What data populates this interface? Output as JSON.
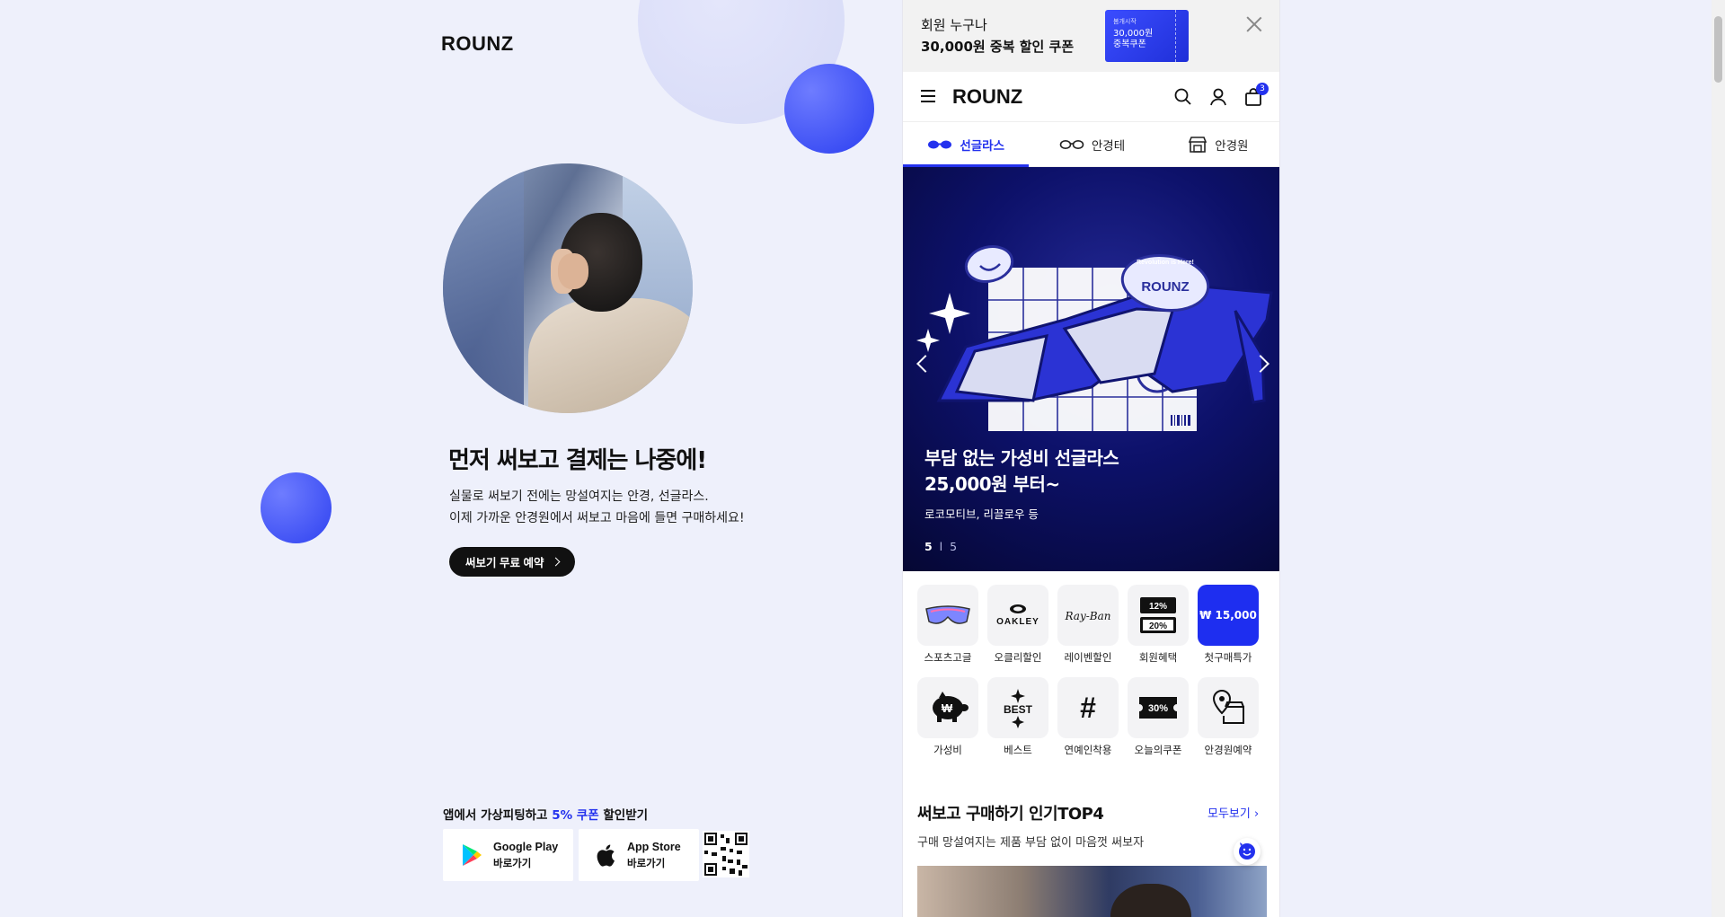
{
  "landing": {
    "brand": "ROUNZ",
    "headline": "먼저 써보고 결제는 나중에!",
    "desc_line1": "실물로 써보기 전에는 망설여지는 안경, 선글라스.",
    "desc_line2": "이제 가까운 안경원에서 써보고 마음에 들면 구매하세요!",
    "try_button": "써보기 무료 예약",
    "app_promo_prefix": "앱에서 가상피팅하고 ",
    "app_promo_highlight": "5% 쿠폰",
    "app_promo_suffix": " 할인받기",
    "google_play": {
      "name": "Google Play",
      "action": "바로가기"
    },
    "app_store": {
      "name": "App Store",
      "action": "바로가기"
    }
  },
  "coupon_bar": {
    "line1": "회원 누구나",
    "line2": "30,000원 중복 할인 쿠폰",
    "ticket_small": "봄개시작",
    "ticket_amount": "30,000원",
    "ticket_label": "중복쿠폰"
  },
  "nav": {
    "brand": "ROUNZ",
    "cart_count": "3"
  },
  "categories": [
    {
      "label": "선글라스",
      "active": true
    },
    {
      "label": "안경테",
      "active": false
    },
    {
      "label": "안경원",
      "active": false
    }
  ],
  "hero": {
    "title_line1": "부담 없는 가성비 선글라스",
    "title_line2": "25,000원 부터~",
    "subtitle": "로코모티브, 리끌로우 등",
    "page_current": "5",
    "page_separator": "l",
    "page_total": "5",
    "art_badge": "ROUNZ",
    "art_badge_small": "Revolution is Here!"
  },
  "quick_menu": [
    {
      "label": "스포츠고글",
      "icon": "goggles-icon"
    },
    {
      "label": "오클리할인",
      "icon": "oakley-logo-icon",
      "logo_text": "OAKLEY"
    },
    {
      "label": "레이벤할인",
      "icon": "rayban-logo-icon",
      "logo_text": "Ray-Ban"
    },
    {
      "label": "회원혜택",
      "icon": "discount-ticket-icon",
      "top_text": "12%",
      "bottom_text": "20%"
    },
    {
      "label": "첫구매특가",
      "icon": "price-tag-icon",
      "box_text": "₩ 15,000"
    },
    {
      "label": "가성비",
      "icon": "piggy-bank-icon"
    },
    {
      "label": "베스트",
      "icon": "best-sparkle-icon",
      "box_text": "BEST"
    },
    {
      "label": "연예인착용",
      "icon": "hashtag-icon",
      "box_text": "#"
    },
    {
      "label": "오늘의쿠폰",
      "icon": "coupon-icon",
      "box_text": "30%"
    },
    {
      "label": "안경원예약",
      "icon": "store-pin-icon"
    }
  ],
  "section": {
    "title": "써보고 구매하기 인기TOP4",
    "more": "모두보기",
    "desc": "구매 망설여지는 제품 부담 없이 마음껏 써보자"
  },
  "colors": {
    "accent": "#2331ee",
    "page_bg": "#eef0fb",
    "hero_bg": "#0d116a"
  }
}
